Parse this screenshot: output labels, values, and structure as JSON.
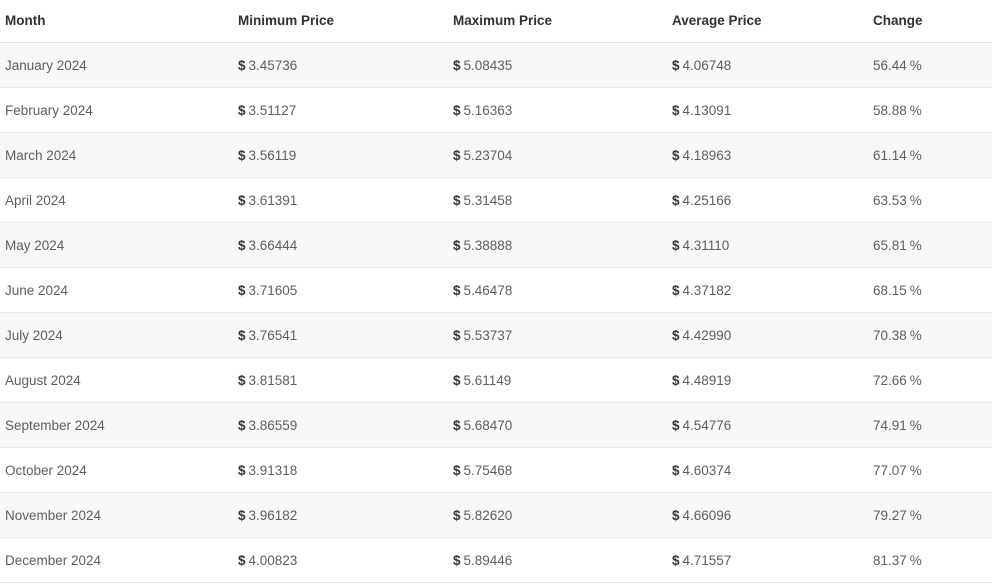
{
  "table": {
    "columns": [
      {
        "key": "month",
        "label": "Month"
      },
      {
        "key": "min",
        "label": "Minimum Price"
      },
      {
        "key": "max",
        "label": "Maximum Price"
      },
      {
        "key": "avg",
        "label": "Average Price"
      },
      {
        "key": "change",
        "label": "Change"
      }
    ],
    "currency_symbol": "$",
    "percent_symbol": "%",
    "rows": [
      {
        "month": "January 2024",
        "min": "3.45736",
        "max": "5.08435",
        "avg": "4.06748",
        "change": "56.44"
      },
      {
        "month": "February 2024",
        "min": "3.51127",
        "max": "5.16363",
        "avg": "4.13091",
        "change": "58.88"
      },
      {
        "month": "March 2024",
        "min": "3.56119",
        "max": "5.23704",
        "avg": "4.18963",
        "change": "61.14"
      },
      {
        "month": "April 2024",
        "min": "3.61391",
        "max": "5.31458",
        "avg": "4.25166",
        "change": "63.53"
      },
      {
        "month": "May 2024",
        "min": "3.66444",
        "max": "5.38888",
        "avg": "4.31110",
        "change": "65.81"
      },
      {
        "month": "June 2024",
        "min": "3.71605",
        "max": "5.46478",
        "avg": "4.37182",
        "change": "68.15"
      },
      {
        "month": "July 2024",
        "min": "3.76541",
        "max": "5.53737",
        "avg": "4.42990",
        "change": "70.38"
      },
      {
        "month": "August 2024",
        "min": "3.81581",
        "max": "5.61149",
        "avg": "4.48919",
        "change": "72.66"
      },
      {
        "month": "September 2024",
        "min": "3.86559",
        "max": "5.68470",
        "avg": "4.54776",
        "change": "74.91"
      },
      {
        "month": "October 2024",
        "min": "3.91318",
        "max": "5.75468",
        "avg": "4.60374",
        "change": "77.07"
      },
      {
        "month": "November 2024",
        "min": "3.96182",
        "max": "5.82620",
        "avg": "4.66096",
        "change": "79.27"
      },
      {
        "month": "December 2024",
        "min": "4.00823",
        "max": "5.89446",
        "avg": "4.71557",
        "change": "81.37"
      }
    ]
  },
  "colors": {
    "header_text": "#2f3338",
    "body_text": "#5a5f63",
    "currency_text": "#33383d",
    "row_stripe": "#f8f8f8",
    "row_plain": "#ffffff",
    "row_border": "#e8e8e8",
    "header_border": "#e4e4e4"
  }
}
